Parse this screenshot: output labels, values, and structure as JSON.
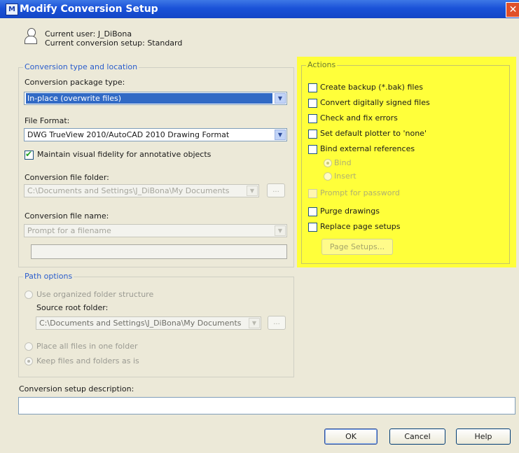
{
  "window": {
    "title": "Modify Conversion Setup",
    "icon_text": "M",
    "close_glyph": "✕"
  },
  "user": {
    "current_user": "Current user: J_DiBona",
    "current_setup": "Current conversion setup: Standard"
  },
  "conversion": {
    "legend": "Conversion type and location",
    "package_type_label": "Conversion package type:",
    "package_type_value": "In-place (overwrite files)",
    "file_format_label": "File Format:",
    "file_format_value": "DWG TrueView 2010/AutoCAD 2010 Drawing Format",
    "fidelity_label": "Maintain visual fidelity for annotative objects",
    "fidelity_checked": true,
    "folder_label": "Conversion file folder:",
    "folder_value": "C:\\Documents and Settings\\J_DiBona\\My Documents",
    "browse_label": "...",
    "name_label": "Conversion file name:",
    "name_value": "Prompt for a filename"
  },
  "path": {
    "legend": "Path options",
    "organized_label": "Use organized folder structure",
    "source_root_label": "Source root folder:",
    "source_root_value": "C:\\Documents and Settings\\J_DiBona\\My Documents",
    "browse_label": "...",
    "one_folder_label": "Place all files in one folder",
    "keep_label": "Keep files and folders as is"
  },
  "description": {
    "label": "Conversion setup description:",
    "value": ""
  },
  "actions": {
    "legend": "Actions",
    "items": [
      "Create backup (*.bak) files",
      "Convert digitally signed files",
      "Check and fix errors",
      "Set default plotter to 'none'",
      "Bind external references"
    ],
    "bind_label": "Bind",
    "insert_label": "Insert",
    "prompt_password_label": "Prompt for password",
    "purge_label": "Purge drawings",
    "replace_label": "Replace page setups",
    "page_setups_button": "Page Setups...",
    "highlight_color": "#ffff3a"
  },
  "buttons": {
    "ok": "OK",
    "cancel": "Cancel",
    "help": "Help"
  },
  "colors": {
    "title_bar": "#1a52d8",
    "dialog_bg": "#ece9d8",
    "selection": "#316ac5",
    "legend_text": "#2a5dcc"
  }
}
